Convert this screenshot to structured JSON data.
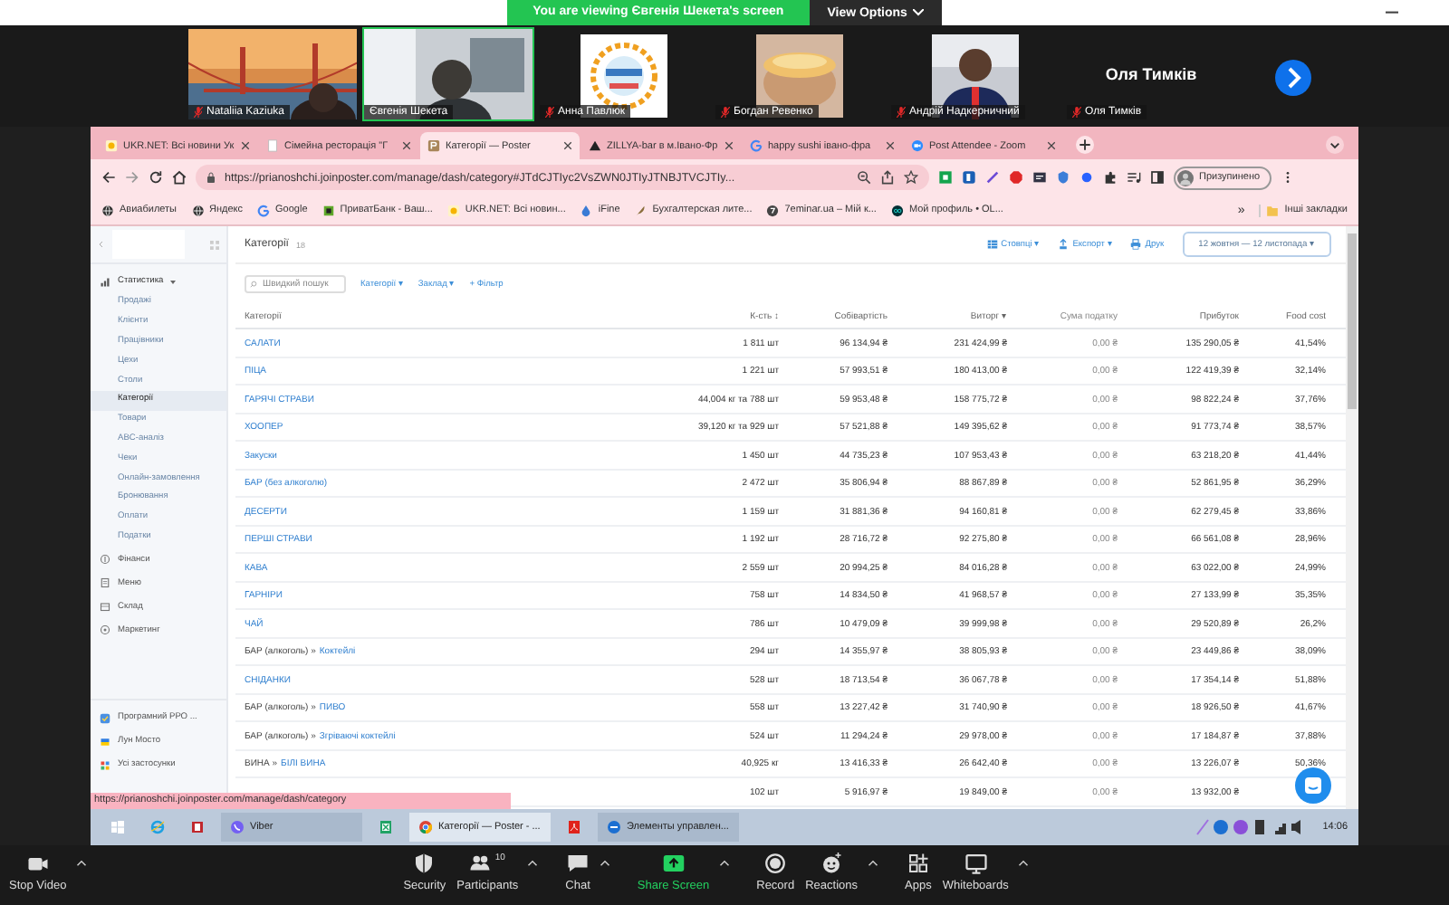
{
  "banner": {
    "text": "You are viewing Євгенія Шекета's screen",
    "button": "View Options"
  },
  "participants": [
    {
      "name": "Nataliia Kaziuka",
      "kind": "picture",
      "muted": true,
      "selected": false
    },
    {
      "name": "Євгенія Шекета",
      "kind": "picture",
      "muted": false,
      "selected": true
    },
    {
      "name": "Анна Павлюк",
      "kind": "picture",
      "muted": true,
      "selected": false
    },
    {
      "name": "Богдан Ревенко",
      "kind": "picture",
      "muted": true,
      "selected": false
    },
    {
      "name": "Андрій Надкерничний",
      "kind": "picture",
      "muted": true,
      "selected": false
    },
    {
      "name": "Оля Тимків",
      "kind": "name",
      "display": "Оля Тимків",
      "muted": true,
      "selected": false
    }
  ],
  "browser": {
    "tabs": [
      {
        "title": "UKR.NET: Всі новини Ук",
        "kind": "ukrnet",
        "selected": false
      },
      {
        "title": "Сімейна ресторація \"Г",
        "kind": "blank",
        "selected": false
      },
      {
        "title": "Категорії — Poster",
        "kind": "poster",
        "selected": true
      },
      {
        "title": "ZILLYA-bar в м.Івано-Фр",
        "kind": "triangle",
        "selected": false
      },
      {
        "title": "happy sushi івано-фра",
        "kind": "google",
        "selected": false
      },
      {
        "title": "Post Attendee - Zoom",
        "kind": "zoom",
        "selected": false
      }
    ],
    "url": "https://prianoshchi.joinposter.com/manage/dash/category#JTdCJTIyc2VsZWN0JTIyJTNBJTVCJTIy...",
    "profile": "Призупинено",
    "bookmarks": [
      {
        "label": "Авиабилеты",
        "kind": "globe"
      },
      {
        "label": "Яндекс",
        "kind": "globe"
      },
      {
        "label": "Google",
        "kind": "google"
      },
      {
        "label": "ПриватБанк - Ваш...",
        "kind": "privat"
      },
      {
        "label": "UKR.NET: Всі новин...",
        "kind": "ukrnet"
      },
      {
        "label": "iFine",
        "kind": "drop"
      },
      {
        "label": "Бухгалтерская лите...",
        "kind": "feather"
      },
      {
        "label": "7eminar.ua – Мій к...",
        "kind": "seven"
      },
      {
        "label": "Мой профиль • OL...",
        "kind": "olx"
      }
    ],
    "more": "»",
    "other_bookmarks": "Інші закладки"
  },
  "sidebar": {
    "groups": [
      {
        "label": "Статистика",
        "kind": "stats",
        "expanded": true,
        "children": [
          {
            "label": "Продажі",
            "selected": false
          },
          {
            "label": "Клієнти",
            "selected": false
          },
          {
            "label": "Працівники",
            "selected": false
          },
          {
            "label": "Цехи",
            "selected": false
          },
          {
            "label": "Столи",
            "selected": false
          },
          {
            "label": "Категорії",
            "selected": true
          },
          {
            "label": "Товари",
            "selected": false
          },
          {
            "label": "ABC-аналіз",
            "selected": false
          },
          {
            "label": "Чеки",
            "selected": false
          },
          {
            "label": "Онлайн-замовлення",
            "selected": false
          },
          {
            "label": "Бронювання",
            "selected": false
          },
          {
            "label": "Оплати",
            "selected": false
          },
          {
            "label": "Податки",
            "selected": false
          }
        ]
      },
      {
        "label": "Фінанси",
        "kind": "finance",
        "expanded": false
      },
      {
        "label": "Меню",
        "kind": "menu",
        "expanded": false
      },
      {
        "label": "Склад",
        "kind": "warehouse",
        "expanded": false
      },
      {
        "label": "Маркетинг",
        "kind": "marketing",
        "expanded": false
      }
    ],
    "apps": [
      {
        "label": "Програмний РРО ...",
        "kind": "rro"
      },
      {
        "label": "Лун Мосто",
        "kind": "mono"
      },
      {
        "label": "Усі застосунки",
        "kind": "grid"
      }
    ]
  },
  "page": {
    "title": "Категорії",
    "count": "18",
    "search_placeholder": "Швидкий пошук",
    "filters": [
      "Категорії ▾",
      "Заклад ▾"
    ],
    "add_filter": "+ Фільтр",
    "actions": [
      {
        "label": "Стовпці ▾",
        "kind": "columns"
      },
      {
        "label": "Експорт ▾",
        "kind": "export"
      },
      {
        "label": "Друк",
        "kind": "print"
      }
    ],
    "date_range": "12 жовтня — 12 листопада ▾"
  },
  "table": {
    "columns": [
      {
        "label": "Категорії",
        "muted": false
      },
      {
        "label": "К-сть ↕",
        "muted": false
      },
      {
        "label": "Собівартість",
        "muted": false
      },
      {
        "label": "Виторг ▾",
        "muted": false
      },
      {
        "label": "Сума податку",
        "muted": true
      },
      {
        "label": "Прибуток",
        "muted": false
      },
      {
        "label": "Food cost",
        "muted": false
      }
    ],
    "rows": [
      {
        "cells": [
          "САЛАТИ",
          "1 811 шт",
          "96 134,94 ₴",
          "231 424,99 ₴",
          "0,00 ₴",
          "135 290,05 ₴",
          "41,54%"
        ]
      },
      {
        "cells": [
          "ПІЦА",
          "1 221 шт",
          "57 993,51 ₴",
          "180 413,00 ₴",
          "0,00 ₴",
          "122 419,39 ₴",
          "32,14%"
        ]
      },
      {
        "cells": [
          "ГАРЯЧІ СТРАВИ",
          "44,004 кг та 788 шт",
          "59 953,48 ₴",
          "158 775,72 ₴",
          "0,00 ₴",
          "98 822,24 ₴",
          "37,76%"
        ]
      },
      {
        "cells": [
          "ХООПЕР",
          "39,120 кг та 929 шт",
          "57 521,88 ₴",
          "149 395,62 ₴",
          "0,00 ₴",
          "91 773,74 ₴",
          "38,57%"
        ]
      },
      {
        "cells": [
          "Закуски",
          "1 450 шт",
          "44 735,23 ₴",
          "107 953,43 ₴",
          "0,00 ₴",
          "63 218,20 ₴",
          "41,44%"
        ]
      },
      {
        "cells": [
          "БАР (без алкоголю)",
          "2 472 шт",
          "35 806,94 ₴",
          "88 867,89 ₴",
          "0,00 ₴",
          "52 861,95 ₴",
          "36,29%"
        ]
      },
      {
        "cells": [
          "ДЕСЕРТИ",
          "1 159 шт",
          "31 881,36 ₴",
          "94 160,81 ₴",
          "0,00 ₴",
          "62 279,45 ₴",
          "33,86%"
        ]
      },
      {
        "cells": [
          "ПЕРШІ СТРАВИ",
          "1 192 шт",
          "28 716,72 ₴",
          "92 275,80 ₴",
          "0,00 ₴",
          "66 561,08 ₴",
          "28,96%"
        ]
      },
      {
        "cells": [
          "КАВА",
          "2 559 шт",
          "20 994,25 ₴",
          "84 016,28 ₴",
          "0,00 ₴",
          "63 022,00 ₴",
          "24,99%"
        ]
      },
      {
        "cells": [
          "ГАРНІРИ",
          "758 шт",
          "14 834,50 ₴",
          "41 968,57 ₴",
          "0,00 ₴",
          "27 133,99 ₴",
          "35,35%"
        ]
      },
      {
        "cells": [
          "ЧАЙ",
          "786 шт",
          "10 479,09 ₴",
          "39 999,98 ₴",
          "0,00 ₴",
          "29 520,89 ₴",
          "26,2%"
        ]
      },
      {
        "parent": "БАР (алкоголь) »",
        "cells": [
          "Коктейлі",
          "294 шт",
          "14 355,97 ₴",
          "38 805,93 ₴",
          "0,00 ₴",
          "23 449,86 ₴",
          "38,09%"
        ]
      },
      {
        "cells": [
          "СНІДАНКИ",
          "528 шт",
          "18 713,54 ₴",
          "36 067,78 ₴",
          "0,00 ₴",
          "17 354,14 ₴",
          "51,88%"
        ]
      },
      {
        "parent": "БАР (алкоголь) »",
        "cells": [
          "ПИВО",
          "558 шт",
          "13 227,42 ₴",
          "31 740,90 ₴",
          "0,00 ₴",
          "18 926,50 ₴",
          "41,67%"
        ]
      },
      {
        "parent": "БАР (алкоголь) »",
        "cells": [
          "Згріваючі коктейлі",
          "524 шт",
          "11 294,24 ₴",
          "29 978,00 ₴",
          "0,00 ₴",
          "17 184,87 ₴",
          "37,88%"
        ]
      },
      {
        "parent": "ВИНА »",
        "cells": [
          "БІЛІ ВИНА",
          "40,925 кг",
          "13 416,33 ₴",
          "26 642,40 ₴",
          "0,00 ₴",
          "13 226,07 ₴",
          "50,36%"
        ]
      },
      {
        "cells": [
          "",
          "102 шт",
          "5 916,97 ₴",
          "19 849,00 ₴",
          "0,00 ₴",
          "13 932,00 ₴"
        ]
      }
    ]
  },
  "status_link": "https://prianoshchi.joinposter.com/manage/dash/category",
  "taskbar": {
    "items": [
      {
        "kind": "windows",
        "selected": false
      },
      {
        "kind": "ie",
        "selected": false
      },
      {
        "kind": "redapp",
        "selected": false
      },
      {
        "kind": "viber",
        "label": "Viber",
        "selected": false
      },
      {
        "kind": "sheet",
        "selected": false
      },
      {
        "kind": "chrome",
        "label": "Категорії — Poster - ...",
        "selected": true
      },
      {
        "kind": "pdf",
        "selected": false
      },
      {
        "kind": "control",
        "label": "Элементы управлен...",
        "selected": false
      }
    ],
    "time": "14:06"
  },
  "zoom_toolbar": [
    {
      "label": "Stop Video",
      "kind": "video",
      "caret": true
    },
    {
      "label": "Security",
      "kind": "security",
      "caret": false
    },
    {
      "label": "Participants",
      "kind": "participants",
      "count": "10",
      "caret": true
    },
    {
      "label": "Chat",
      "kind": "chat",
      "caret": true
    },
    {
      "label": "Share Screen",
      "kind": "share",
      "caret": true
    },
    {
      "label": "Record",
      "kind": "record",
      "caret": false
    },
    {
      "label": "Reactions",
      "kind": "reactions",
      "caret": true
    },
    {
      "label": "Apps",
      "kind": "apps",
      "caret": false
    },
    {
      "label": "Whiteboards",
      "kind": "whiteboard",
      "caret": true
    }
  ]
}
